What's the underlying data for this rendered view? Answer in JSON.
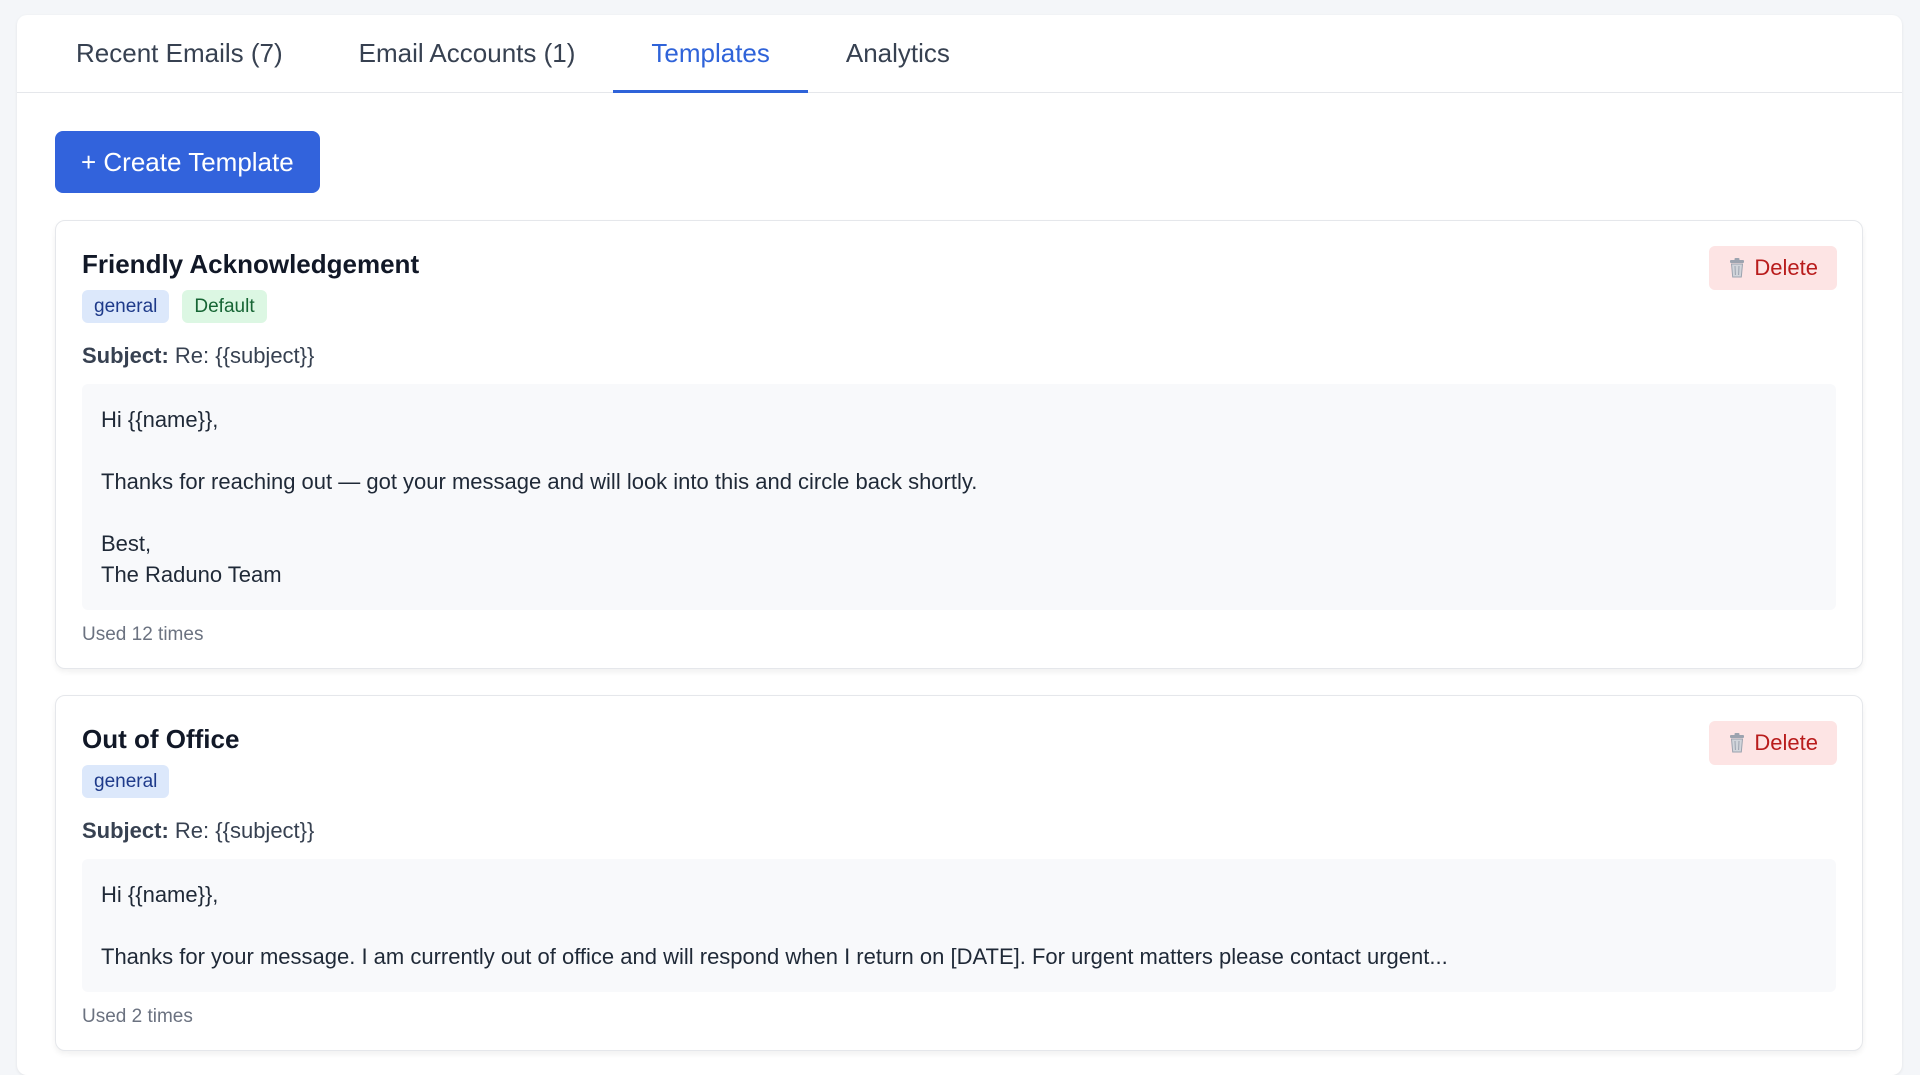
{
  "tabs": [
    {
      "label": "Recent Emails (7)",
      "active": false
    },
    {
      "label": "Email Accounts (1)",
      "active": false
    },
    {
      "label": "Templates",
      "active": true
    },
    {
      "label": "Analytics",
      "active": false
    }
  ],
  "toolbar": {
    "create_label": "+ Create Template"
  },
  "subject_label": "Subject:",
  "delete_label": "Delete",
  "templates": [
    {
      "title": "Friendly Acknowledgement",
      "tags": [
        "general",
        "Default"
      ],
      "subject": "Re: {{subject}}",
      "body": [
        "Hi {{name}},",
        "",
        "Thanks for reaching out — got your message and will look into this and circle back shortly.",
        "",
        "Best,",
        "The Raduno Team"
      ],
      "usage": "Used 12 times"
    },
    {
      "title": "Out of Office",
      "tags": [
        "general"
      ],
      "subject": "Re: {{subject}}",
      "body": [
        "Hi {{name}},",
        "",
        "Thanks for your message. I am currently out of office and will respond when I return on [DATE]. For urgent matters please contact urgent..."
      ],
      "usage": "Used 2 times"
    }
  ],
  "colors": {
    "accent": "#3263dc",
    "delete_bg": "#fde4e4",
    "delete_text": "#b91c1c"
  },
  "icons": {
    "delete": "trash-icon"
  }
}
